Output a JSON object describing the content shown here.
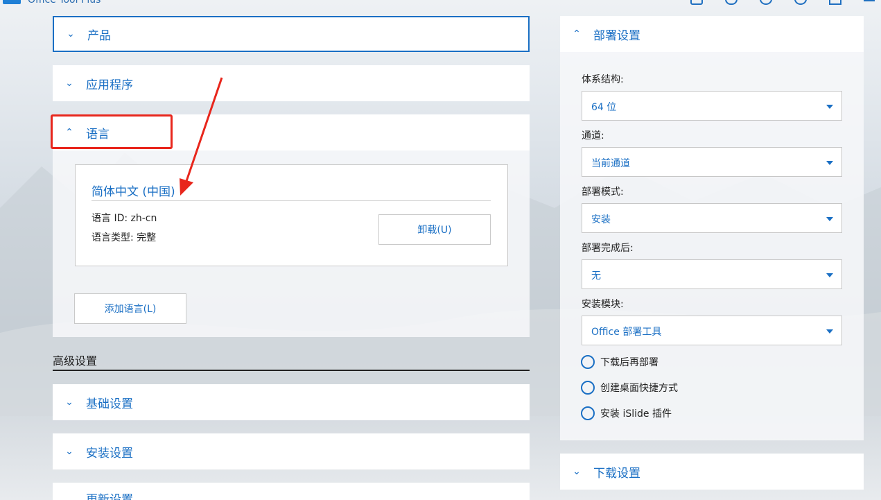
{
  "app": {
    "title": "Office Tool Plus"
  },
  "left": {
    "products": {
      "label": "产品"
    },
    "apps": {
      "label": "应用程序"
    },
    "language": {
      "label": "语言",
      "card": {
        "title": "简体中文 (中国)",
        "id_text": "语言 ID: zh-cn",
        "type_text": "语言类型: 完整",
        "uninstall_label": "卸载(U)"
      },
      "add_label": "添加语言(L)"
    },
    "advanced": {
      "title": "高级设置",
      "basic": {
        "label": "基础设置"
      },
      "install": {
        "label": "安装设置"
      },
      "update": {
        "label": "更新设置"
      }
    }
  },
  "right": {
    "deploy": {
      "label": "部署设置",
      "fields": [
        {
          "label": "体系结构:",
          "value": "64 位"
        },
        {
          "label": "通道:",
          "value": "当前通道"
        },
        {
          "label": "部署模式:",
          "value": "安装"
        },
        {
          "label": "部署完成后:",
          "value": "无"
        },
        {
          "label": "安装模块:",
          "value": "Office 部署工具"
        }
      ],
      "options": [
        {
          "label": "下载后再部署"
        },
        {
          "label": "创建桌面快捷方式"
        },
        {
          "label": "安装 iSlide 插件"
        }
      ]
    },
    "download": {
      "label": "下载设置"
    }
  },
  "colors": {
    "accent": "#1a6fc4",
    "annotation": "#e8261c"
  }
}
